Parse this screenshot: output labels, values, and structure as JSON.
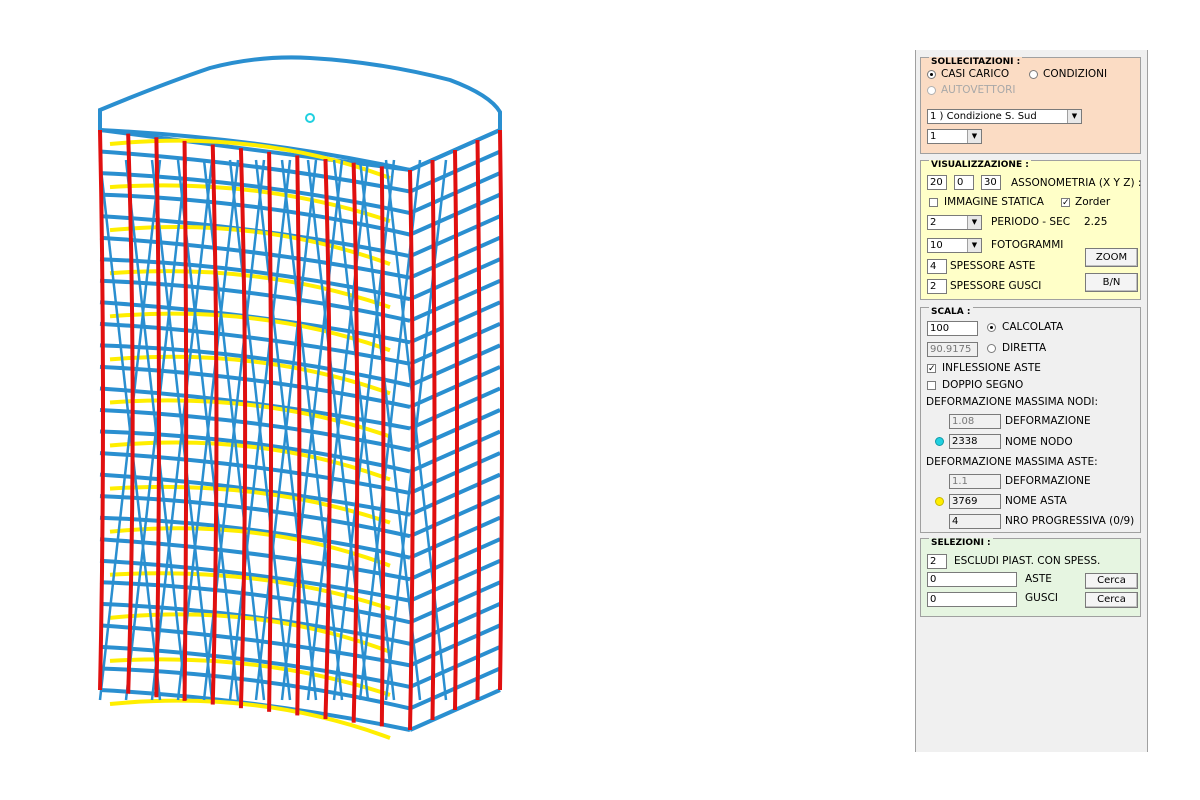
{
  "sollecitazioni": {
    "title": "SOLLECITAZIONI :",
    "casi_carico": "CASI CARICO",
    "condizioni": "CONDIZIONI",
    "autovettori": "AUTOVETTORI",
    "condition_select": "1 ) Condizione S. Sud",
    "sub_select": "1"
  },
  "visualizzazione": {
    "title": "VISUALIZZAZIONE :",
    "axo_x": "20",
    "axo_y": "0",
    "axo_z": "30",
    "axo_label": "ASSONOMETRIA (X Y Z) :",
    "immagine_statica": "IMMAGINE STATICA",
    "zorder": "Zorder",
    "periodo_select": "2",
    "periodo_label": "PERIODO - SEC",
    "periodo_value": "2.25",
    "fotogrammi_select": "10",
    "fotogrammi_label": "FOTOGRAMMI",
    "zoom_button": "ZOOM",
    "spessore_aste_value": "4",
    "spessore_aste_label": "SPESSORE ASTE",
    "spessore_gusci_value": "2",
    "spessore_gusci_label": "SPESSORE GUSCI",
    "bn_button": "B/N"
  },
  "scala": {
    "title": "SCALA :",
    "calcolata_value": "100",
    "calcolata_label": "CALCOLATA",
    "diretta_value": "90.9175",
    "diretta_label": "DIRETTA",
    "inflessione": "INFLESSIONE ASTE",
    "doppio_segno": "DOPPIO SEGNO",
    "def_max_nodi": "DEFORMAZIONE MASSIMA NODI:",
    "nodi_def_value": "1.08",
    "nodi_def_label": "DEFORMAZIONE",
    "nodo_name_value": "2338",
    "nodo_name_label": "NOME NODO",
    "def_max_aste": "DEFORMAZIONE MASSIMA ASTE:",
    "aste_def_value": "1.1",
    "aste_def_label": "DEFORMAZIONE",
    "asta_name_value": "3769",
    "asta_name_label": "NOME ASTA",
    "nro_value": "4",
    "nro_label": "NRO PROGRESSIVA (0/9)"
  },
  "selezioni": {
    "title": "SELEZIONI :",
    "escludi_value": "2",
    "escludi_label": "ESCLUDI PIAST. CON SPESS.",
    "aste_value": "0",
    "aste_label": "ASTE",
    "gusci_value": "0",
    "gusci_label": "GUSCI",
    "cerca": "Cerca"
  },
  "colors": {
    "sollecitazioni_bg": "#fbdcc4",
    "visualizzazione_bg": "#ffffc8",
    "scala_bg": "#f0f0f0",
    "selezioni_bg": "#e6f5e1",
    "beam_blue": "#2a8fd0",
    "column_red": "#e01010",
    "deformed_yellow": "#ffee00",
    "node_marker": "#20d0e0",
    "asta_marker": "#ffee00"
  }
}
